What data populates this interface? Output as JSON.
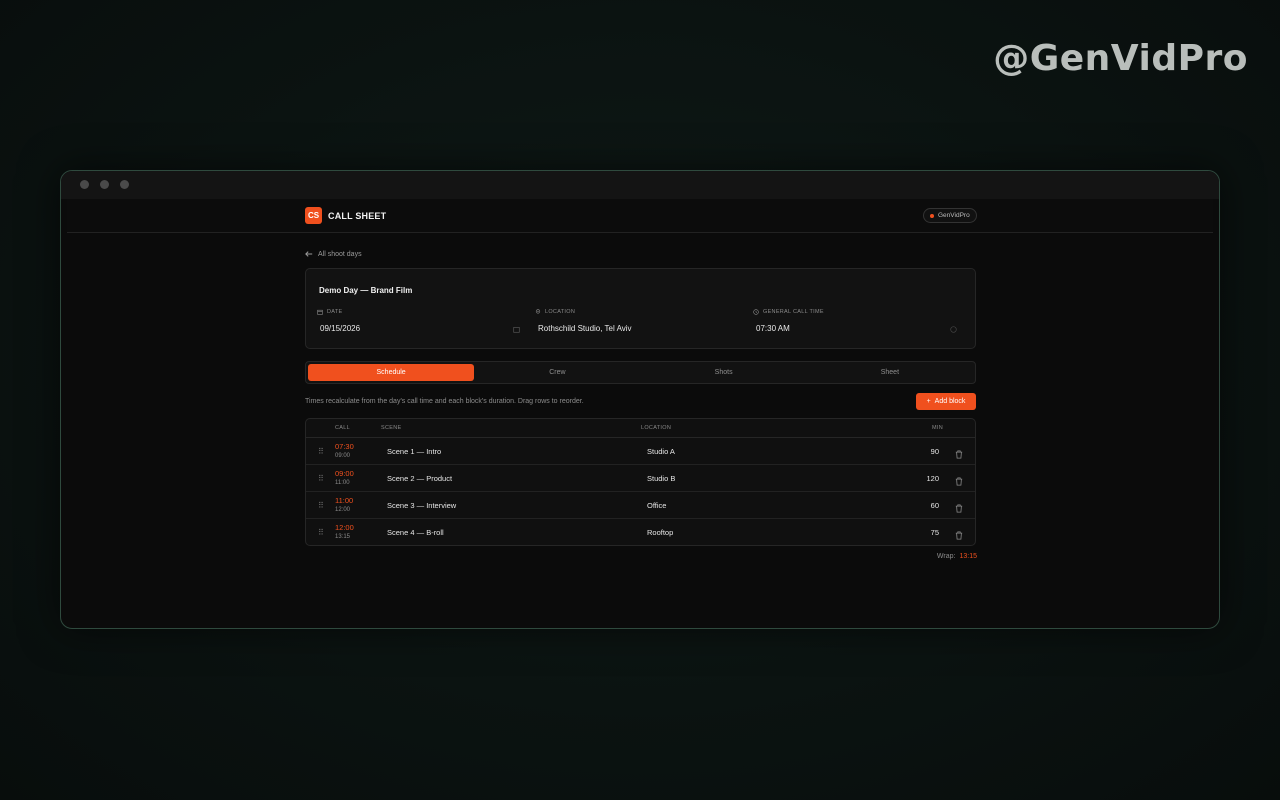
{
  "watermark": "@GenVidPro",
  "app": {
    "logo_text": "CS",
    "brand": "CALL SHEET",
    "badge": "GenVidPro"
  },
  "nav": {
    "back_label": "All shoot days"
  },
  "shoot": {
    "title": "Demo Day — Brand Film",
    "date_label": "DATE",
    "date_value": "09/15/2026",
    "location_label": "LOCATION",
    "location_value": "Rothschild Studio, Tel Aviv",
    "call_label": "GENERAL CALL TIME",
    "call_value": "07:30 AM"
  },
  "tabs": [
    {
      "label": "Schedule",
      "active": true
    },
    {
      "label": "Crew",
      "active": false
    },
    {
      "label": "Shots",
      "active": false
    },
    {
      "label": "Sheet",
      "active": false
    }
  ],
  "schedule": {
    "hint": "Times recalculate from the day's call time and each block's duration. Drag rows to reorder.",
    "add_label": "Add block",
    "columns": {
      "call": "CALL",
      "scene": "SCENE",
      "location": "LOCATION",
      "min": "MIN"
    },
    "rows": [
      {
        "start": "07:30",
        "end": "09:00",
        "scene": "Scene 1 — Intro",
        "location": "Studio A",
        "min": "90"
      },
      {
        "start": "09:00",
        "end": "11:00",
        "scene": "Scene 2 — Product",
        "location": "Studio B",
        "min": "120"
      },
      {
        "start": "11:00",
        "end": "12:00",
        "scene": "Scene 3 — Interview",
        "location": "Office",
        "min": "60"
      },
      {
        "start": "12:00",
        "end": "13:15",
        "scene": "Scene 4 — B-roll",
        "location": "Rooftop",
        "min": "75"
      }
    ],
    "wrap_label": "Wrap:",
    "wrap_value": "13:15"
  },
  "colors": {
    "accent": "#f0501e",
    "background": "#0b0b0b",
    "frame": "#2f4a3e"
  }
}
